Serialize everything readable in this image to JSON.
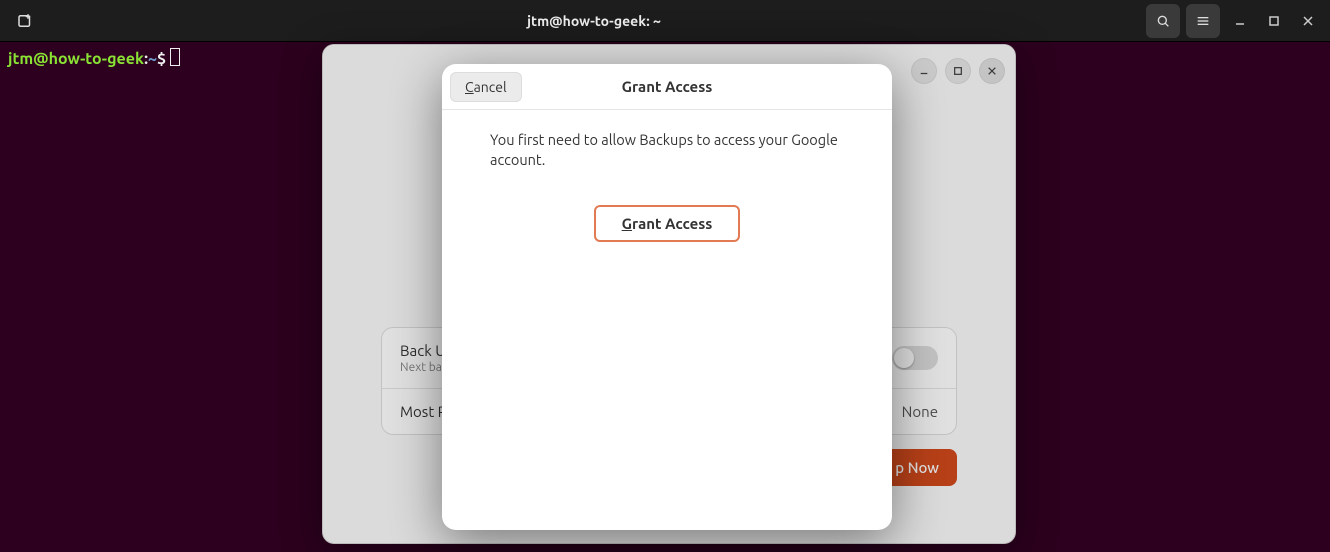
{
  "titlebar": {
    "title": "jtm@how-to-geek: ~"
  },
  "terminal": {
    "user_host": "jtm@how-to-geek",
    "colon": ":",
    "path": "~",
    "prompt": "$"
  },
  "backups": {
    "rows": {
      "auto": {
        "label": "Back Up",
        "sub": "Next bac"
      },
      "recent": {
        "label": "Most R",
        "value": "None"
      }
    },
    "backup_now": "p Now"
  },
  "dialog": {
    "cancel_prefix": "C",
    "cancel_rest": "ancel",
    "title": "Grant Access",
    "message": "You first need to allow Backups to access your Google account.",
    "grant_prefix": "G",
    "grant_rest": "rant Access"
  }
}
